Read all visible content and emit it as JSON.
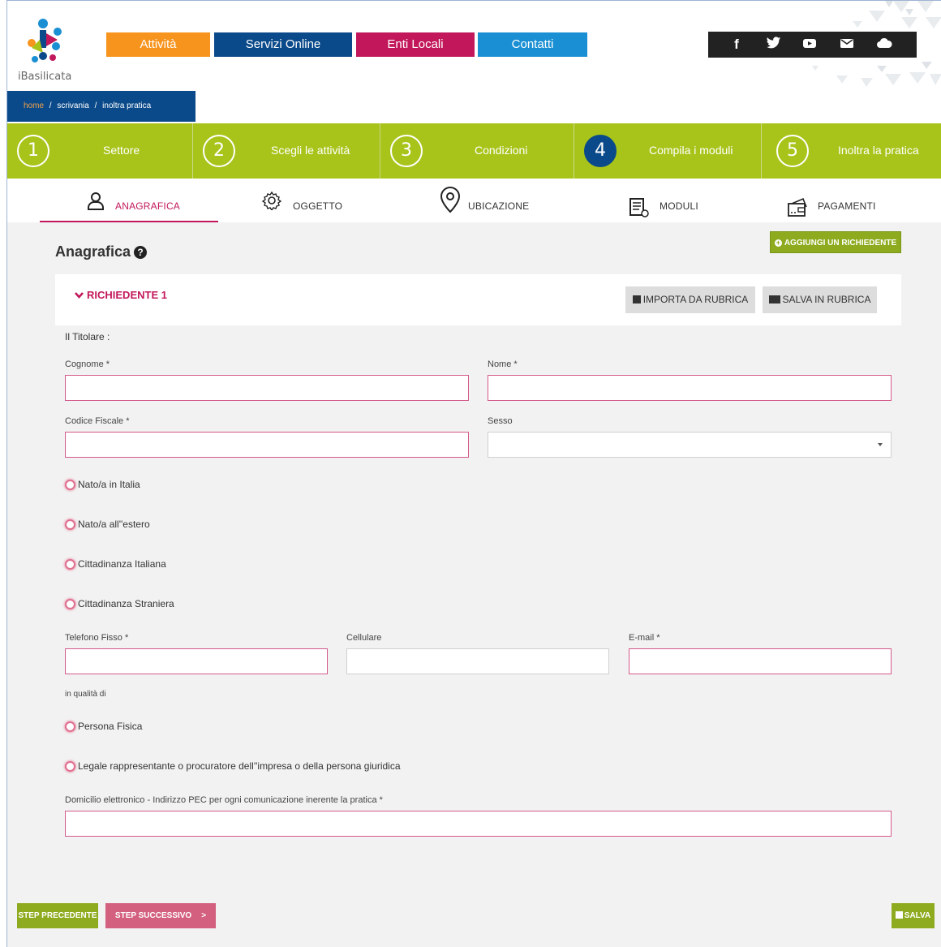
{
  "header": {
    "logo_text": "iBasilicata",
    "nav": [
      {
        "label": "Attività",
        "color": "#f7941d"
      },
      {
        "label": "Servizi Online",
        "color": "#0b4a8a"
      },
      {
        "label": "Enti Locali",
        "color": "#c2185b"
      },
      {
        "label": "Contatti",
        "color": "#1b8fd3"
      }
    ],
    "social_icons": [
      "facebook-icon",
      "twitter-icon",
      "youtube-icon",
      "email-icon",
      "cloud-icon"
    ],
    "social_glyphs": [
      "f",
      "🐦",
      "▶",
      "✉",
      "☁"
    ]
  },
  "breadcrumb": {
    "home": "home",
    "sep1": "/",
    "scrivania": "scrivania",
    "sep2": "/",
    "current": "inoltra pratica"
  },
  "steps": [
    {
      "num": "1",
      "label": "Settore"
    },
    {
      "num": "2",
      "label": "Scegli le attività"
    },
    {
      "num": "3",
      "label": "Condizioni"
    },
    {
      "num": "4",
      "label": "Compila i moduli",
      "active": true
    },
    {
      "num": "5",
      "label": "Inoltra la pratica"
    }
  ],
  "tabs": [
    {
      "label": "ANAGRAFICA",
      "icon": "user-icon",
      "active": true
    },
    {
      "label": "OGGETTO",
      "icon": "gear-icon"
    },
    {
      "label": "UBICAZIONE",
      "icon": "location-pin-icon"
    },
    {
      "label": "MODULI",
      "icon": "document-icon"
    },
    {
      "label": "PAGAMENTI",
      "icon": "wallet-icon"
    }
  ],
  "main": {
    "title": "Anagrafica",
    "help_glyph": "?",
    "add_button": "AGGIUNGI UN RICHIEDENTE",
    "richiedente_label": "RICHIEDENTE 1",
    "import_button": "IMPORTA DA RUBRICA",
    "save_rubrica_button": "SALVA IN RUBRICA",
    "titolare": "Il Titolare :",
    "fields": {
      "cognome": {
        "label": "Cognome *",
        "value": ""
      },
      "nome": {
        "label": "Nome *",
        "value": ""
      },
      "codice_fiscale": {
        "label": "Codice Fiscale *",
        "value": ""
      },
      "sesso": {
        "label": "Sesso",
        "value": ""
      },
      "telefono": {
        "label": "Telefono Fisso *",
        "value": ""
      },
      "cellulare": {
        "label": "Cellulare",
        "value": ""
      },
      "email": {
        "label": "E-mail *",
        "value": ""
      },
      "pec": {
        "label": "Domicilio elettronico - Indirizzo PEC per ogni comunicazione inerente la pratica *",
        "value": ""
      }
    },
    "radios_nascita": [
      "Nato/a in Italia",
      "Nato/a all''estero",
      "Cittadinanza Italiana",
      "Cittadinanza Straniera"
    ],
    "in_qualita": "in qualità di",
    "radios_qualita": [
      "Persona Fisica",
      "Legale rappresentante o procuratore dell''impresa o della persona giuridica"
    ]
  },
  "footer": {
    "prev": "STEP PRECEDENTE",
    "next": "STEP SUCCESSIVO",
    "next_arrow": ">",
    "save": "SALVA"
  }
}
